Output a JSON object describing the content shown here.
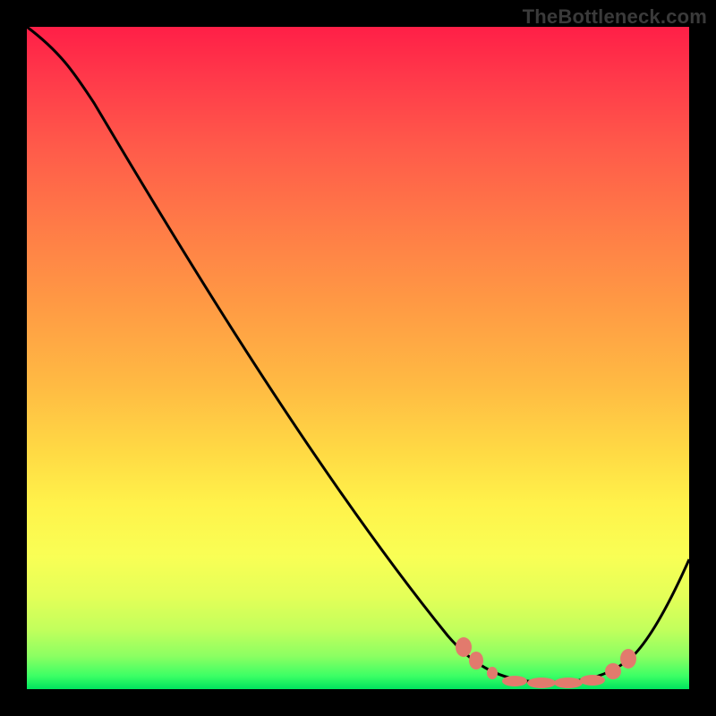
{
  "watermark": "TheBottleneck.com",
  "colors": {
    "background": "#000000",
    "gradient_top": "#ff1f47",
    "gradient_mid": "#ffd944",
    "gradient_bottom": "#00e45e",
    "curve": "#000000",
    "markers": "#e27a6d"
  },
  "chart_data": {
    "type": "line",
    "title": "",
    "xlabel": "",
    "ylabel": "",
    "xlim": [
      0,
      100
    ],
    "ylim": [
      0,
      100
    ],
    "note": "No axis ticks or numeric labels are shown; x treated as 0-100 horizontal %, y as 0-100 bottleneck % (top of plot = 100).",
    "series": [
      {
        "name": "bottleneck-curve",
        "x": [
          0,
          4,
          8,
          12,
          16,
          20,
          24,
          28,
          32,
          36,
          40,
          44,
          48,
          52,
          56,
          60,
          64,
          68,
          72,
          76,
          80,
          84,
          88,
          92,
          96,
          100
        ],
        "y": [
          100,
          97,
          93,
          88,
          82,
          76,
          70,
          64,
          58,
          52,
          46,
          40,
          34,
          28,
          22,
          17,
          12,
          8,
          4,
          2,
          1,
          1,
          2,
          5,
          11,
          20
        ]
      }
    ],
    "markers": {
      "name": "highlight-segment",
      "x": [
        67,
        70,
        73,
        76,
        79,
        82,
        85,
        88,
        90
      ],
      "y": [
        7,
        4,
        3,
        2,
        1,
        1,
        2,
        3,
        4
      ]
    }
  }
}
